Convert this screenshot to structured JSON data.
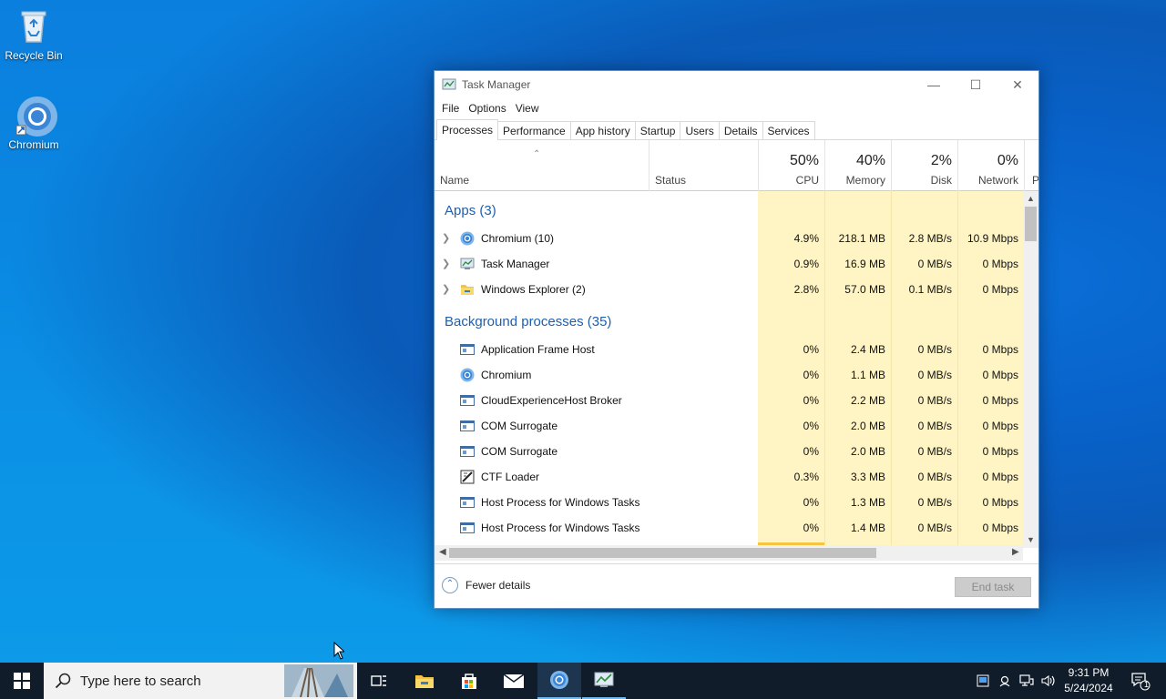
{
  "desktop": {
    "icons": [
      {
        "label": "Recycle Bin",
        "icon": "recycle-bin-icon"
      },
      {
        "label": "Chromium",
        "icon": "chromium-icon"
      }
    ]
  },
  "window": {
    "title": "Task Manager",
    "menu": [
      "File",
      "Options",
      "View"
    ],
    "tabs": [
      "Processes",
      "Performance",
      "App history",
      "Startup",
      "Users",
      "Details",
      "Services"
    ],
    "active_tab": "Processes",
    "columns": {
      "name": "Name",
      "status": "Status",
      "cpu": {
        "pct": "50%",
        "label": "CPU"
      },
      "memory": {
        "pct": "40%",
        "label": "Memory"
      },
      "disk": {
        "pct": "2%",
        "label": "Disk"
      },
      "network": {
        "pct": "0%",
        "label": "Network"
      },
      "power": "P"
    },
    "groups": {
      "apps": "Apps (3)",
      "background": "Background processes (35)"
    },
    "apps": [
      {
        "name": "Chromium (10)",
        "icon": "chromium-icon",
        "cpu": "4.9%",
        "memory": "218.1 MB",
        "disk": "2.8 MB/s",
        "network": "10.9 Mbps"
      },
      {
        "name": "Task Manager",
        "icon": "task-manager-icon",
        "cpu": "0.9%",
        "memory": "16.9 MB",
        "disk": "0 MB/s",
        "network": "0 Mbps"
      },
      {
        "name": "Windows Explorer (2)",
        "icon": "folder-icon",
        "cpu": "2.8%",
        "memory": "57.0 MB",
        "disk": "0.1 MB/s",
        "network": "0 Mbps"
      }
    ],
    "background": [
      {
        "name": "Application Frame Host",
        "icon": "app-window-icon",
        "cpu": "0%",
        "memory": "2.4 MB",
        "disk": "0 MB/s",
        "network": "0 Mbps"
      },
      {
        "name": "Chromium",
        "icon": "chromium-icon",
        "cpu": "0%",
        "memory": "1.1 MB",
        "disk": "0 MB/s",
        "network": "0 Mbps"
      },
      {
        "name": "CloudExperienceHost Broker",
        "icon": "app-window-icon",
        "cpu": "0%",
        "memory": "2.2 MB",
        "disk": "0 MB/s",
        "network": "0 Mbps"
      },
      {
        "name": "COM Surrogate",
        "icon": "app-window-icon",
        "cpu": "0%",
        "memory": "2.0 MB",
        "disk": "0 MB/s",
        "network": "0 Mbps"
      },
      {
        "name": "COM Surrogate",
        "icon": "app-window-icon",
        "cpu": "0%",
        "memory": "2.0 MB",
        "disk": "0 MB/s",
        "network": "0 Mbps"
      },
      {
        "name": "CTF Loader",
        "icon": "ctf-loader-icon",
        "cpu": "0.3%",
        "memory": "3.3 MB",
        "disk": "0 MB/s",
        "network": "0 Mbps"
      },
      {
        "name": "Host Process for Windows Tasks",
        "icon": "app-window-icon",
        "cpu": "0%",
        "memory": "1.3 MB",
        "disk": "0 MB/s",
        "network": "0 Mbps"
      },
      {
        "name": "Host Process for Windows Tasks",
        "icon": "app-window-icon",
        "cpu": "0%",
        "memory": "1.4 MB",
        "disk": "0 MB/s",
        "network": "0 Mbps"
      }
    ],
    "footer": {
      "fewer_details": "Fewer details",
      "end_task": "End task"
    }
  },
  "taskbar": {
    "search_placeholder": "Type here to search",
    "pinned": [
      "task-view-icon",
      "file-explorer-icon",
      "store-icon",
      "mail-icon",
      "chromium-icon",
      "task-manager-icon"
    ],
    "clock": {
      "time": "9:31 PM",
      "date": "5/24/2024"
    },
    "notifications": "1"
  }
}
